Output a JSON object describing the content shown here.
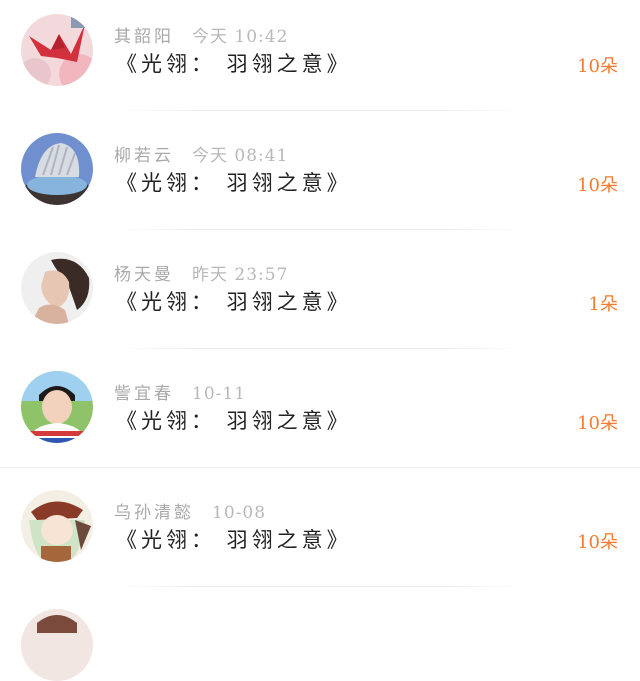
{
  "items": [
    {
      "name": "其韶阳",
      "time": "今天 10:42",
      "title": "《光翎：  羽翎之意》",
      "count": "10朵"
    },
    {
      "name": "柳若云",
      "time": "今天 08:41",
      "title": "《光翎：  羽翎之意》",
      "count": "10朵"
    },
    {
      "name": "杨天曼",
      "time": "昨天 23:57",
      "title": "《光翎：  羽翎之意》",
      "count": "1朵"
    },
    {
      "name": "訾宜春",
      "time": "10-11",
      "title": "《光翎：  羽翎之意》",
      "count": "10朵"
    },
    {
      "name": "乌孙清懿",
      "time": "10-08",
      "title": "《光翎：  羽翎之意》",
      "count": "10朵"
    }
  ],
  "colors": {
    "accent": "#f47b31",
    "meta": "#a9a9a9",
    "title": "#222222"
  }
}
